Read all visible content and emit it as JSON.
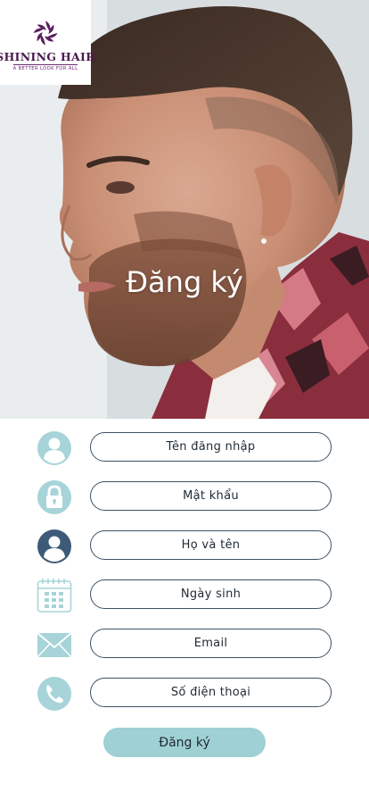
{
  "brand": {
    "name": "SHINING HAIR",
    "tagline": "A BETTER LOOK FOR ALL"
  },
  "hero": {
    "title": "Đăng ký"
  },
  "form": {
    "fields": [
      {
        "placeholder": "Tên đăng nhập",
        "icon": "user-icon"
      },
      {
        "placeholder": "Mật khẩu",
        "icon": "lock-icon"
      },
      {
        "placeholder": "Họ và tên",
        "icon": "user-dark-icon"
      },
      {
        "placeholder": "Ngày sinh",
        "icon": "calendar-icon"
      },
      {
        "placeholder": "Email",
        "icon": "envelope-icon"
      },
      {
        "placeholder": "Số điện thoại",
        "icon": "phone-icon"
      }
    ],
    "submit_label": "Đăng ký"
  },
  "colors": {
    "accent": "#9fd0d4",
    "icon_light": "#a6d4d8",
    "icon_dark": "#3d5a78",
    "field_border": "#3c5266",
    "brand": "#4a1a4f"
  }
}
